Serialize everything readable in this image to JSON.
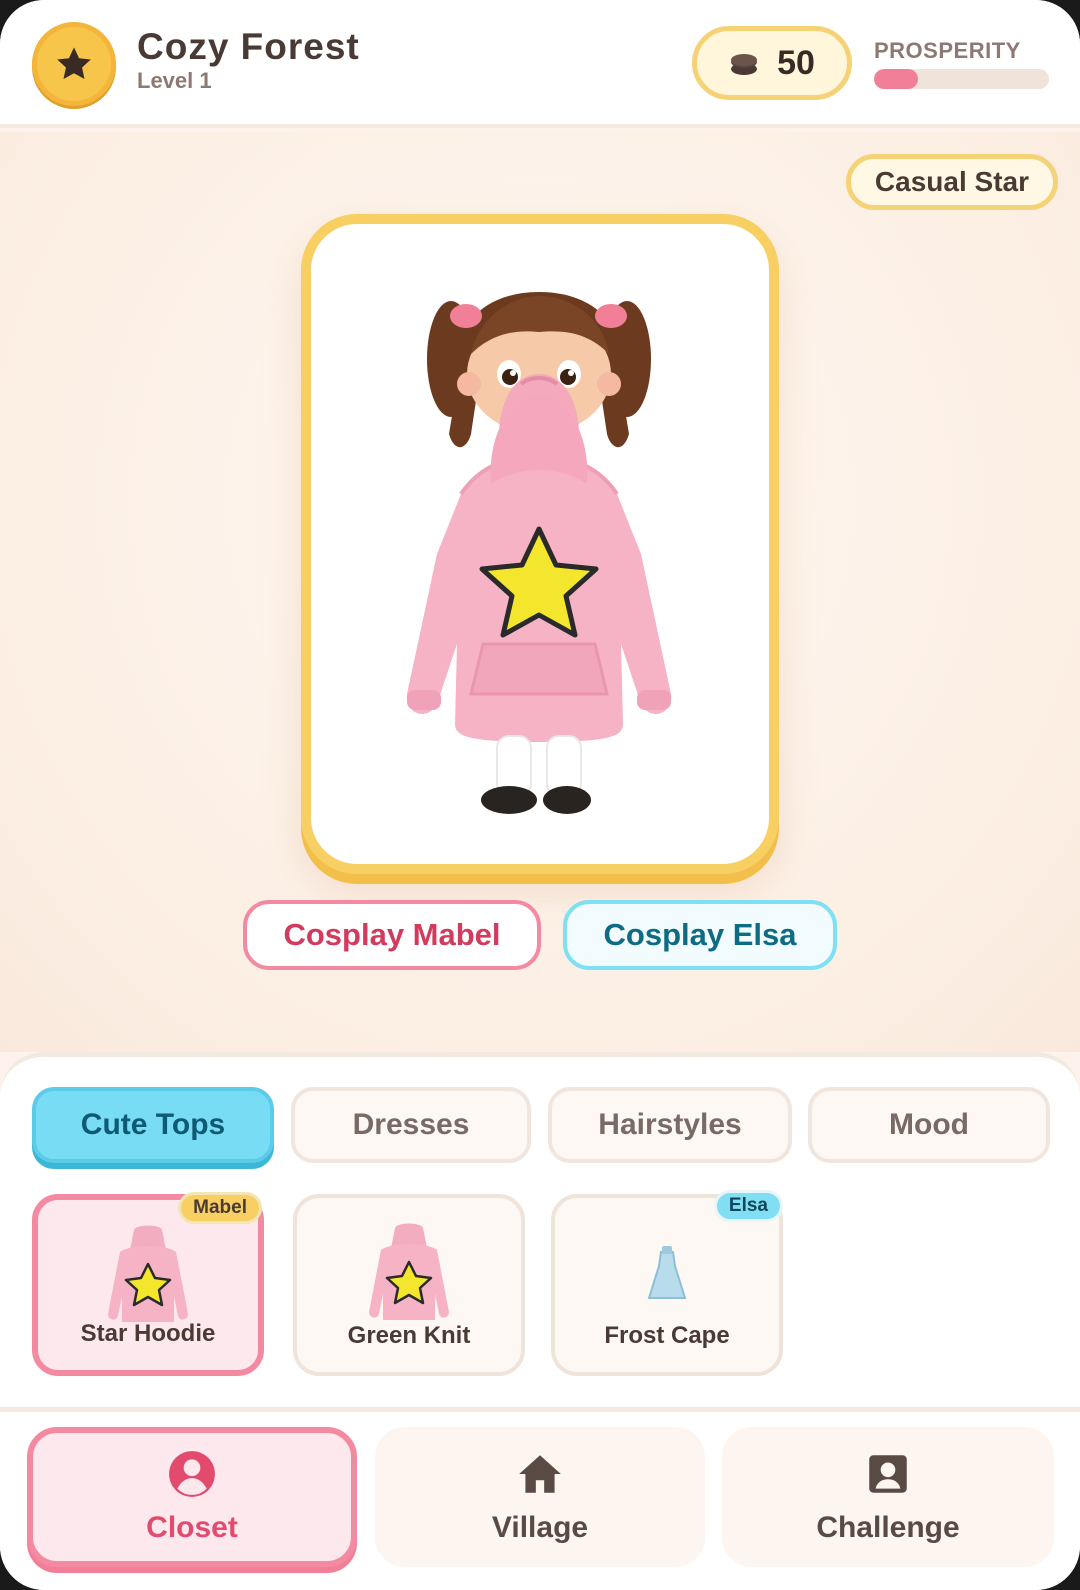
{
  "header": {
    "star_icon": "star-icon",
    "title": "Cozy Forest",
    "level": "Level 1",
    "coins": {
      "icon": "coin-stack-icon",
      "value": "50"
    },
    "prosperity": {
      "label": "PROSPERITY",
      "fraction": 0.25
    }
  },
  "stage": {
    "outfit_chip": "Casual Star",
    "portrait": "character-portrait",
    "cosplay_buttons": [
      {
        "label": "Cosplay Mabel"
      },
      {
        "label": "Cosplay Elsa"
      }
    ]
  },
  "closet": {
    "tabs": [
      {
        "label": "Cute Tops",
        "active": true
      },
      {
        "label": "Dresses",
        "active": false
      },
      {
        "label": "Hairstyles",
        "active": false
      },
      {
        "label": "Mood",
        "active": false
      }
    ],
    "items": [
      {
        "name": "Star Hoodie",
        "tag": "Mabel",
        "selected": true,
        "icon": "pink-star-hoodie-icon"
      },
      {
        "name": "Green Knit",
        "tag": "",
        "selected": false,
        "icon": "pink-star-hoodie-icon"
      },
      {
        "name": "Frost Cape",
        "tag": "Elsa",
        "selected": false,
        "icon": "blue-dress-icon"
      }
    ]
  },
  "nav": [
    {
      "label": "Closet",
      "icon": "person-circle-icon",
      "active": true
    },
    {
      "label": "Village",
      "icon": "home-icon",
      "active": false
    },
    {
      "label": "Challenge",
      "icon": "portrait-icon",
      "active": false
    }
  ],
  "colors": {
    "accent_pink": "#f48aa2",
    "accent_yellow": "#f8cf63",
    "accent_cyan": "#79dcf5",
    "text_dark": "#4a3a34"
  }
}
